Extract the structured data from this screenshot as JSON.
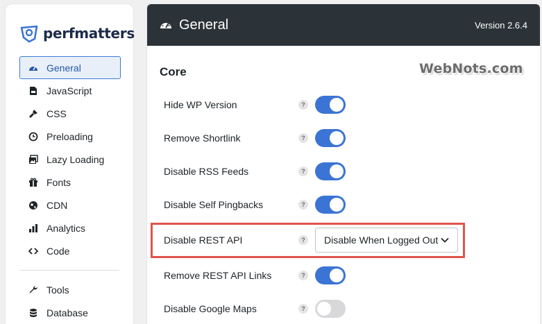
{
  "brand": {
    "name": "perfmatters"
  },
  "sidebar": {
    "items": [
      {
        "label": "General",
        "icon": "dashboard-icon",
        "active": true
      },
      {
        "label": "JavaScript",
        "icon": "javascript-file-icon"
      },
      {
        "label": "CSS",
        "icon": "brush-icon"
      },
      {
        "label": "Preloading",
        "icon": "clock-icon"
      },
      {
        "label": "Lazy Loading",
        "icon": "images-icon"
      },
      {
        "label": "Fonts",
        "icon": "gift-icon"
      },
      {
        "label": "CDN",
        "icon": "globe-icon"
      },
      {
        "label": "Analytics",
        "icon": "bar-chart-icon"
      },
      {
        "label": "Code",
        "icon": "code-icon"
      }
    ],
    "tools": [
      {
        "label": "Tools",
        "icon": "wrench-icon"
      },
      {
        "label": "Database",
        "icon": "database-icon"
      }
    ]
  },
  "header": {
    "title": "General",
    "version": "Version 2.6.4",
    "icon": "dashboard-icon"
  },
  "watermark": "WebNots.com",
  "section": {
    "title": "Core",
    "options": [
      {
        "label": "Hide WP Version",
        "help": "?",
        "type": "toggle",
        "enabled": true
      },
      {
        "label": "Remove Shortlink",
        "help": "?",
        "type": "toggle",
        "enabled": true
      },
      {
        "label": "Disable RSS Feeds",
        "help": "?",
        "type": "toggle",
        "enabled": true
      },
      {
        "label": "Disable Self Pingbacks",
        "help": "?",
        "type": "toggle",
        "enabled": true
      },
      {
        "label": "Disable REST API",
        "help": "?",
        "type": "select",
        "value": "Disable When Logged Out"
      },
      {
        "label": "Remove REST API Links",
        "help": "?",
        "type": "toggle",
        "enabled": true
      },
      {
        "label": "Disable Google Maps",
        "help": "?",
        "type": "toggle",
        "enabled": false
      }
    ]
  },
  "colors": {
    "accent": "#3b74d4",
    "header_bg": "#2c3338",
    "highlight": "#e0544a",
    "toggle_off": "#d8d8db"
  }
}
